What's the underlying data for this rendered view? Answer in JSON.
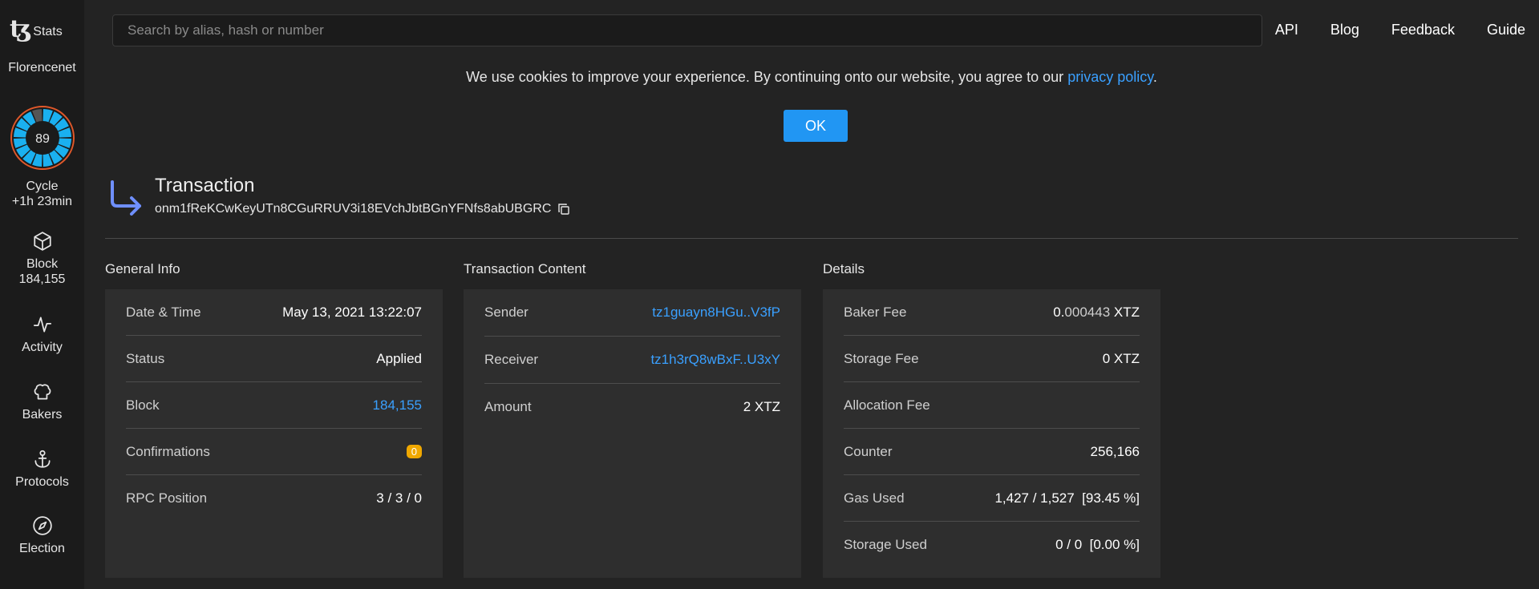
{
  "sidebar": {
    "logo_text": "Stats",
    "network": "Florencenet",
    "cycle": {
      "number": "89",
      "label": "Cycle",
      "remaining": "+1h 23min",
      "progress": 0.95
    },
    "block": {
      "label": "Block",
      "value": "184,155"
    },
    "items": [
      {
        "label": "Activity",
        "icon": "activity-icon"
      },
      {
        "label": "Bakers",
        "icon": "chef-hat-icon"
      },
      {
        "label": "Protocols",
        "icon": "anchor-icon"
      },
      {
        "label": "Election",
        "icon": "compass-icon"
      }
    ]
  },
  "header": {
    "search_placeholder": "Search by alias, hash or number",
    "nav": [
      "API",
      "Blog",
      "Feedback",
      "Guide"
    ]
  },
  "cookie": {
    "text": "We use cookies to improve your experience. By continuing onto our website, you agree to our",
    "link": "privacy policy",
    "period": ".",
    "button": "OK"
  },
  "transaction": {
    "title": "Transaction",
    "hash": "onm1fReKCwKeyUTn8CGuRRUV3i18EVchJbtBGnYFNfs8abUBGRC"
  },
  "general_info": {
    "title": "General Info",
    "rows": [
      {
        "label": "Date & Time",
        "value": "May 13, 2021 13:22:07"
      },
      {
        "label": "Status",
        "value": "Applied"
      },
      {
        "label": "Block",
        "value": "184,155"
      },
      {
        "label": "Confirmations",
        "value": "0"
      },
      {
        "label": "RPC Position",
        "value": "3 / 3 / 0"
      }
    ]
  },
  "transaction_content": {
    "title": "Transaction Content",
    "rows": [
      {
        "label": "Sender",
        "value": "tz1guayn8HGu..V3fP"
      },
      {
        "label": "Receiver",
        "value": "tz1h3rQ8wBxF..U3xY"
      },
      {
        "label": "Amount",
        "value": "2 XTZ"
      }
    ]
  },
  "details": {
    "title": "Details",
    "rows": [
      {
        "label": "Baker Fee",
        "value_main": "0.",
        "value_rest": "000443",
        "unit": "XTZ"
      },
      {
        "label": "Storage Fee",
        "value_main": "0",
        "unit": "XTZ"
      },
      {
        "label": "Allocation Fee",
        "value_main": ""
      },
      {
        "label": "Counter",
        "value_main": "256,166"
      },
      {
        "label": "Gas Used",
        "value_main": "1,427 / 1,527  [93.45 %]"
      },
      {
        "label": "Storage Used",
        "value_main": "0 / 0  [0.00 %]"
      }
    ]
  },
  "colors": {
    "accent": "#2196f3",
    "link": "#3aa0ff",
    "badge": "#f0a800",
    "gauge": "#1ab0f0",
    "gauge_ring": "#e0582a"
  }
}
